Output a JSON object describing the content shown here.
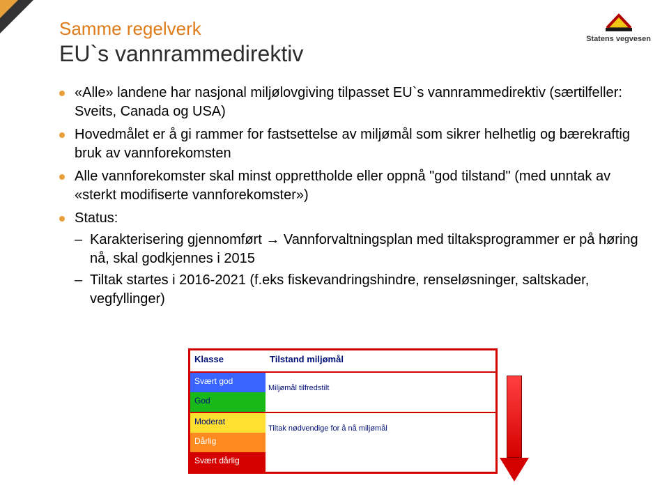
{
  "logo": {
    "org": "Statens vegvesen"
  },
  "kicker": "Samme regelverk",
  "title": "EU`s vannrammedirektiv",
  "bullets": {
    "b1": "«Alle» landene har nasjonal miljølovgiving tilpasset EU`s vannrammedirektiv (særtilfeller: Sveits, Canada og USA)",
    "b2": "Hovedmålet er å gi rammer for fastsettelse av miljømål som sikrer helhetlig og bærekraftig bruk av vannforekomsten",
    "b3": "Alle vannforekomster skal minst opprettholde eller oppnå \"god tilstand\" (med unntak av «sterkt modifiserte vannforekomster»)",
    "b4": "Status:",
    "sub1_a": "Karakterisering gjennomført ",
    "sub1_arrow": "→",
    "sub1_b": " Vannforvaltningsplan med tiltaksprogrammer er på høring nå, skal godkjennes i 2015",
    "sub2": "Tiltak startes i 2016-2021 (f.eks fiskevandringshindre, renseløsninger, saltskader, vegfyllinger)"
  },
  "table": {
    "hdr_klass": "Klasse",
    "hdr_tilstand": "Tilstand miljømål",
    "rows": {
      "svgod": "Svært god",
      "god": "God",
      "moderat": "Moderat",
      "darlig": "Dårlig",
      "svdarlig": "Svært dårlig"
    },
    "goal_ok": "Miljømål tilfredstilt",
    "goal_need": "Tiltak nødvendige for å nå miljømål"
  }
}
